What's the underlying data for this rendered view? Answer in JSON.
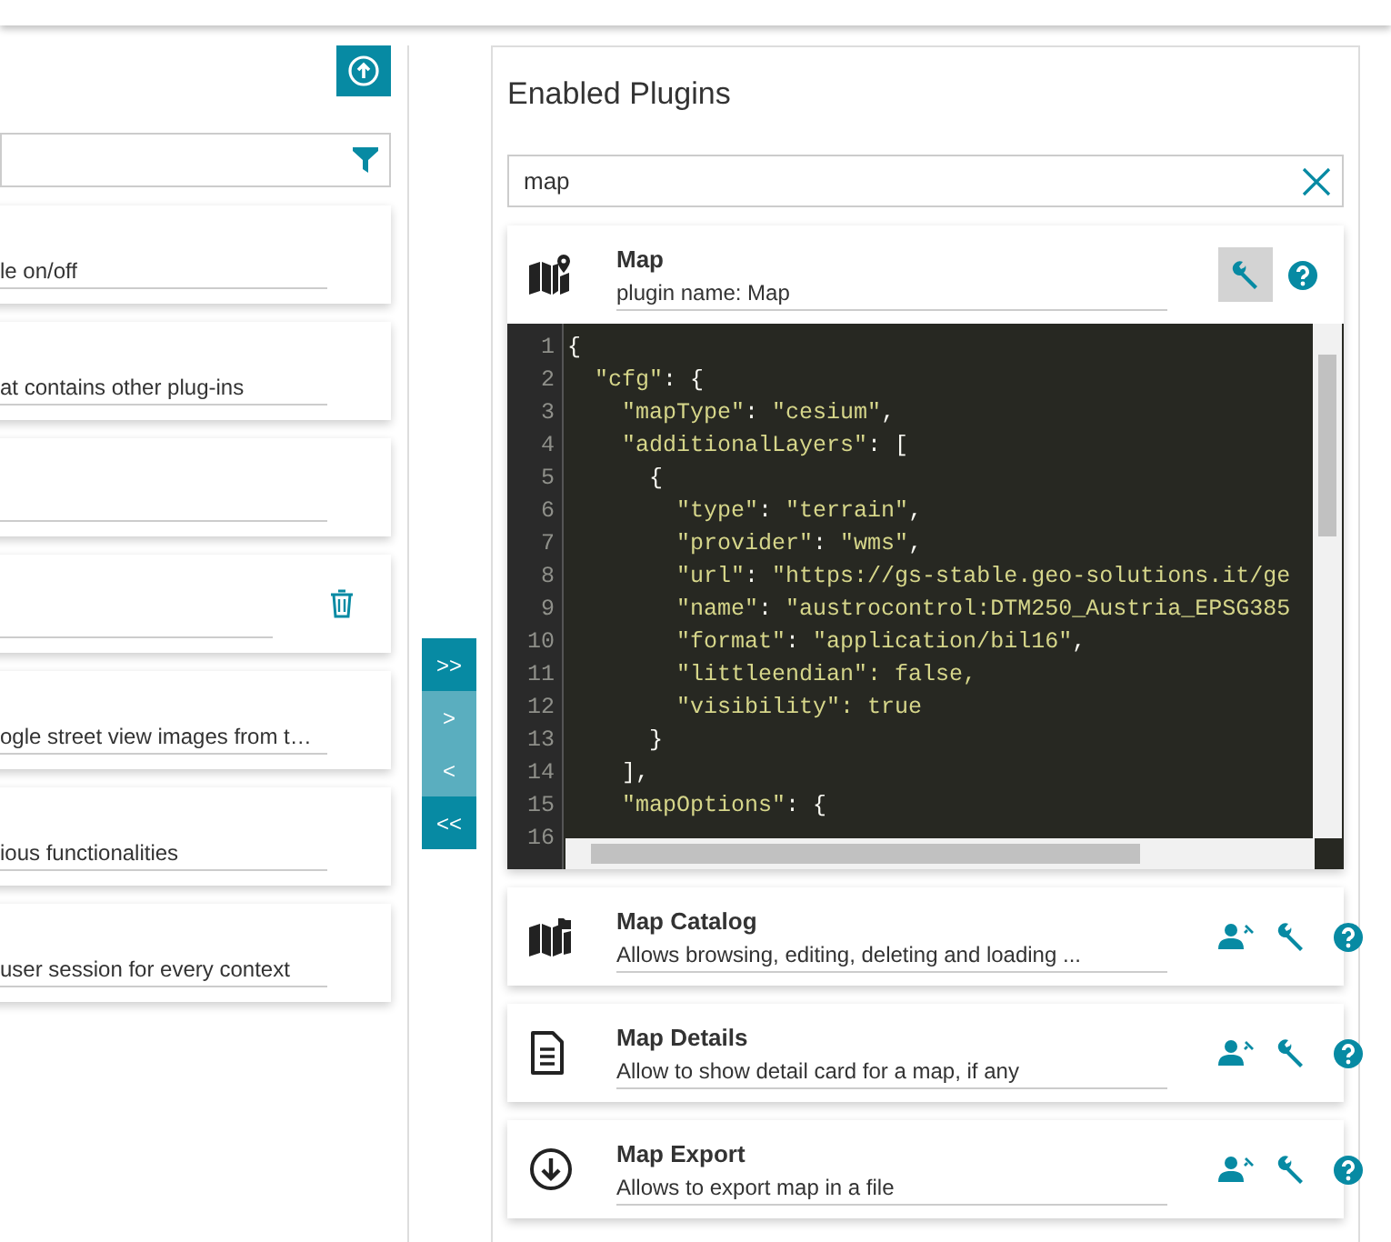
{
  "left_panel": {
    "cards": [
      {
        "kind": "text",
        "description": "le on/off"
      },
      {
        "kind": "text",
        "description": "at contains other plug-ins"
      },
      {
        "kind": "blank"
      },
      {
        "kind": "removable"
      },
      {
        "kind": "text",
        "description": "ogle street view images from t…"
      },
      {
        "kind": "text",
        "description": "ious functionalities"
      },
      {
        "kind": "text",
        "description": "user session for every context"
      }
    ]
  },
  "transfer_buttons": [
    {
      "label": ">>",
      "disabled": false
    },
    {
      "label": ">",
      "disabled": true
    },
    {
      "label": "<",
      "disabled": true
    },
    {
      "label": "<<",
      "disabled": false
    }
  ],
  "right_panel": {
    "title": "Enabled Plugins",
    "search": {
      "value": "map"
    },
    "plugins": [
      {
        "kind": "map",
        "title": "Map",
        "description": "plugin name: Map",
        "user_config": false,
        "configuring": true,
        "editor": {
          "lines": [
            {
              "number": "1",
              "code": "{"
            },
            {
              "number": "2",
              "code": "  \"cfg\": {"
            },
            {
              "number": "3",
              "code": "    \"mapType\": \"cesium\","
            },
            {
              "number": "4",
              "code": "    \"additionalLayers\": ["
            },
            {
              "number": "5",
              "code": "      {"
            },
            {
              "number": "6",
              "code": "        \"type\": \"terrain\","
            },
            {
              "number": "7",
              "code": "        \"provider\": \"wms\","
            },
            {
              "number": "8",
              "code": "        \"url\": \"https://gs-stable.geo-solutions.it/ge"
            },
            {
              "number": "9",
              "code": "        \"name\": \"austrocontrol:DTM250_Austria_EPSG385"
            },
            {
              "number": "10",
              "code": "        \"format\": \"application/bil16\","
            },
            {
              "number": "11",
              "code": "        \"littleendian\": false,"
            },
            {
              "number": "12",
              "code": "        \"visibility\": true"
            },
            {
              "number": "13",
              "code": "      }"
            },
            {
              "number": "14",
              "code": "    ],"
            },
            {
              "number": "15",
              "code": "    \"mapOptions\": {"
            },
            {
              "number": "16"
            }
          ]
        }
      },
      {
        "kind": "catalog",
        "title": "Map Catalog",
        "description": "Allows browsing, editing, deleting and loading ...",
        "user_config": true,
        "configuring": false
      },
      {
        "kind": "details",
        "title": "Map Details",
        "description": "Allow to show detail card for a map, if any",
        "user_config": true,
        "configuring": false
      },
      {
        "kind": "export",
        "title": "Map Export",
        "description": "Allows to export map in a file",
        "user_config": true,
        "configuring": false
      }
    ]
  }
}
